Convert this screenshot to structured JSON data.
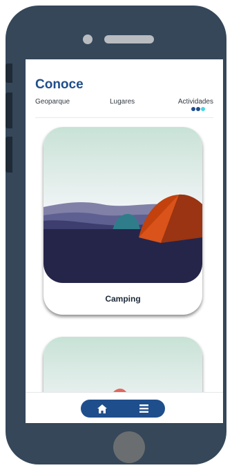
{
  "header": {
    "title": "Conoce"
  },
  "tabs": [
    {
      "label": "Geoparque"
    },
    {
      "label": "Lugares"
    },
    {
      "label": "Actividades"
    }
  ],
  "cards": [
    {
      "label": "Camping",
      "icon": "camping-tent-icon"
    },
    {
      "label": "",
      "icon": "activity-illustration-icon"
    }
  ],
  "bottom_nav": {
    "items": [
      {
        "icon": "home-icon"
      },
      {
        "icon": "menu-icon"
      }
    ]
  },
  "colors": {
    "brand_blue": "#1f4e8c",
    "accent_cyan": "#45d6e0",
    "phone_frame": "#354759",
    "tent_orange": "#c2410c"
  }
}
